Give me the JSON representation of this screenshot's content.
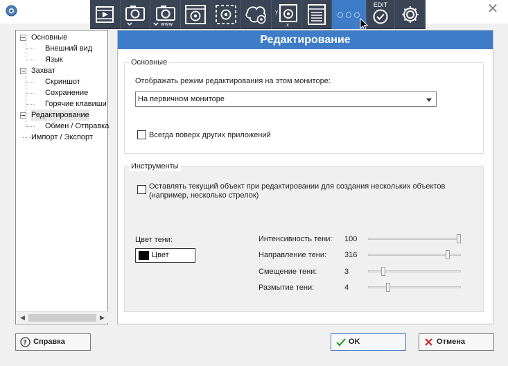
{
  "toolbar": {
    "items": [
      {
        "icon": "video-capture-icon"
      },
      {
        "icon": "camera-capture-icon"
      },
      {
        "icon": "camera-www-capture-icon"
      },
      {
        "icon": "window-capture-icon"
      },
      {
        "icon": "region-capture-icon"
      },
      {
        "icon": "freehand-capture-icon"
      },
      {
        "icon": "fixed-size-capture-icon"
      },
      {
        "icon": "scrolling-capture-icon"
      },
      {
        "icon": "more-options-icon",
        "active": true
      },
      {
        "icon": "edit-check-icon",
        "label": "EDIT"
      },
      {
        "icon": "settings-gear-icon"
      }
    ],
    "edit_label": "EDIT",
    "fixed_label_y": "y",
    "fixed_label_x": "x",
    "www_label": "www",
    "accent_color": "#3e7cc8",
    "background_color": "#3a4454"
  },
  "tree": {
    "items": [
      {
        "label": "Основные",
        "level": 0
      },
      {
        "label": "Внешний вид",
        "level": 1
      },
      {
        "label": "Язык",
        "level": 1
      },
      {
        "label": "Захват",
        "level": 0
      },
      {
        "label": "Скриншот",
        "level": 1
      },
      {
        "label": "Сохранение",
        "level": 1
      },
      {
        "label": "Горячие клавиши",
        "level": 1
      },
      {
        "label": "Редактирование",
        "level": 0,
        "selected": true
      },
      {
        "label": "Обмен / Отправка",
        "level": 1
      },
      {
        "label": "Импорт / Экспорт",
        "level": 0
      }
    ]
  },
  "panel": {
    "title": "Редактирование",
    "basic": {
      "title": "Основные",
      "monitor_label": "Отображать режим редактирования на этом мониторе:",
      "monitor_value": "На первичном мониторе",
      "always_on_top_label": "Всегда поверх других приложений",
      "always_on_top_checked": false
    },
    "tools": {
      "title": "Инструменты",
      "keep_object_label_line1": "Оставлять текущий объект при редактировании для создания нескольких объектов",
      "keep_object_label_line2": "(например, несколько стрелок)",
      "keep_object_checked": false,
      "shadow_color_label": "Цвет тени:",
      "color_button_label": "Цвет",
      "shadow_color": "#000000",
      "shadow": [
        {
          "label": "Интенсивность тени:",
          "value": "100",
          "min": 0,
          "max": 100
        },
        {
          "label": "Направление тени:",
          "value": "316",
          "min": 0,
          "max": 360
        },
        {
          "label": "Смещение тени:",
          "value": "3",
          "min": 0,
          "max": 20
        },
        {
          "label": "Размытие тени:",
          "value": "4",
          "min": 0,
          "max": 20
        }
      ]
    }
  },
  "buttons": {
    "help": "Справка",
    "ok": "OK",
    "cancel": "Отмена"
  }
}
